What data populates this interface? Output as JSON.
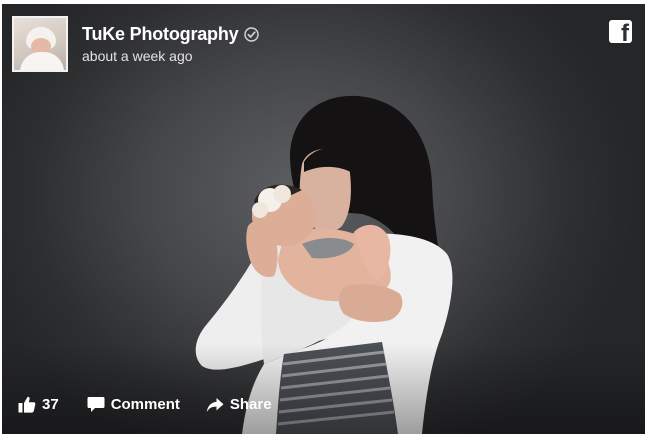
{
  "post": {
    "page_name": "TuKe Photography",
    "timestamp": "about a week ago",
    "verified_icon": "verified-check-icon",
    "brand_icon": "facebook-logo-icon"
  },
  "photo": {
    "subject": "woman-kissing-newborn",
    "background_color": "#45464a"
  },
  "actions": {
    "like_count": "37",
    "comment_label": "Comment",
    "share_label": "Share",
    "like_icon": "thumbs-up-icon",
    "comment_icon": "speech-bubble-icon",
    "share_icon": "share-arrow-icon"
  }
}
